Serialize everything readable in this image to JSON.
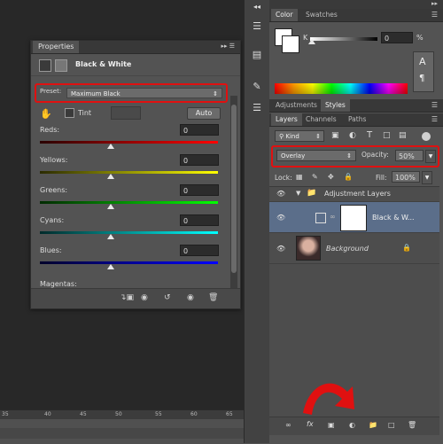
{
  "workspace": {
    "ruler_labels": [
      "35",
      "40",
      "45",
      "50",
      "55",
      "60",
      "65"
    ]
  },
  "properties": {
    "tab_label": "Properties",
    "title": "Black & White",
    "preset_label": "Preset:",
    "preset_value": "Maximum Black",
    "tint_label": "Tint",
    "auto_label": "Auto",
    "sliders": [
      {
        "label": "Reds:",
        "value": "0",
        "color_start": "#2a0000",
        "color_end": "#ff0000",
        "level": 0.4
      },
      {
        "label": "Yellows:",
        "value": "0",
        "color_start": "#2a2a00",
        "color_end": "#ffff00",
        "level": 0.4
      },
      {
        "label": "Greens:",
        "value": "0",
        "color_start": "#002a00",
        "color_end": "#00ff00",
        "level": 0.4
      },
      {
        "label": "Cyans:",
        "value": "0",
        "color_start": "#002a2a",
        "color_end": "#00ffff",
        "level": 0.4
      },
      {
        "label": "Blues:",
        "value": "0",
        "color_start": "#00002a",
        "color_end": "#0000ff",
        "level": 0.4
      }
    ],
    "magentas_label": "Magentas:"
  },
  "color_panel": {
    "tabs": [
      "Color",
      "Swatches"
    ],
    "k_label": "K",
    "k_value": "0",
    "k_unit": "%"
  },
  "adjust_tabs": [
    "Adjustments",
    "Styles"
  ],
  "layers": {
    "tabs": [
      "Layers",
      "Channels",
      "Paths"
    ],
    "kind_label": "Kind",
    "blend_mode": "Overlay",
    "opacity_label": "Opacity:",
    "opacity_value": "50%",
    "lock_label": "Lock:",
    "fill_label": "Fill:",
    "fill_value": "100%",
    "group_name": "Adjustment Layers",
    "adj_layer_name": "Black & W...",
    "bg_layer_name": "Background"
  },
  "colors": {
    "highlight_red": "#e01010",
    "panel_bg": "#535353",
    "selected_layer": "#5b6e8a"
  }
}
